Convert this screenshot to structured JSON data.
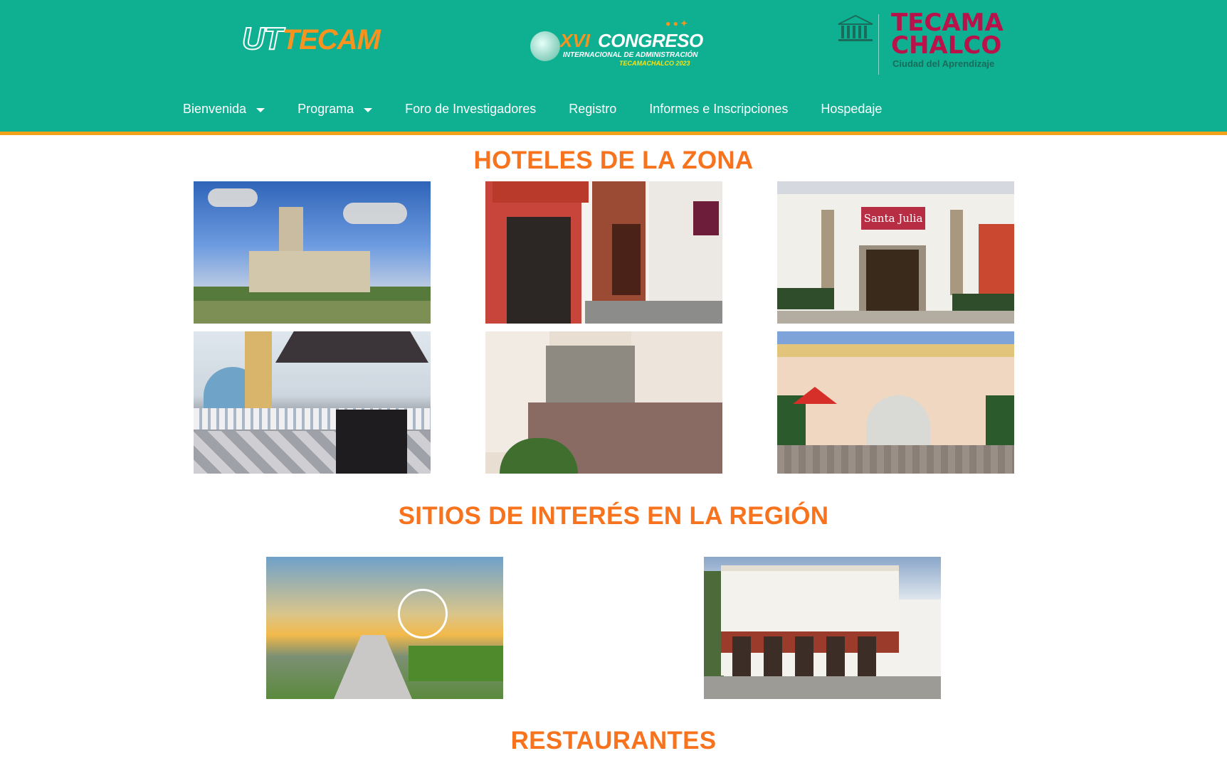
{
  "header": {
    "logo_uttecam_prefix": "UT",
    "logo_uttecam_suffix": "TECAM",
    "congress": {
      "roman": "XVI",
      "title": "CONGRESO",
      "subtitle": "INTERNACIONAL DE ADMINISTRACIÓN",
      "subtitle2": "TECAMACHALCO 2023"
    },
    "tecama": {
      "line1": "TECAMA",
      "line2": "CHALCO",
      "tagline": "Ciudad del Aprendizaje"
    }
  },
  "nav": {
    "items": [
      {
        "label": "Bienvenida",
        "dropdown": true
      },
      {
        "label": "Programa",
        "dropdown": true
      },
      {
        "label": "Foro de Investigadores",
        "dropdown": false
      },
      {
        "label": "Registro",
        "dropdown": false
      },
      {
        "label": "Informes e Inscripciones",
        "dropdown": false
      },
      {
        "label": "Hospedaje",
        "dropdown": false
      }
    ]
  },
  "sections": {
    "hotels_title": "HOTELES DE LA ZONA",
    "sites_title": "SITIOS DE INTERÉS EN LA REGIÓN",
    "restaurants_title": "RESTAURANTES"
  },
  "photos": {
    "hotel_3_sign": "Santa Julia"
  },
  "colors": {
    "header_bg": "#0fb092",
    "accent_orange": "#f7731e",
    "header_border": "#f2a21b"
  }
}
